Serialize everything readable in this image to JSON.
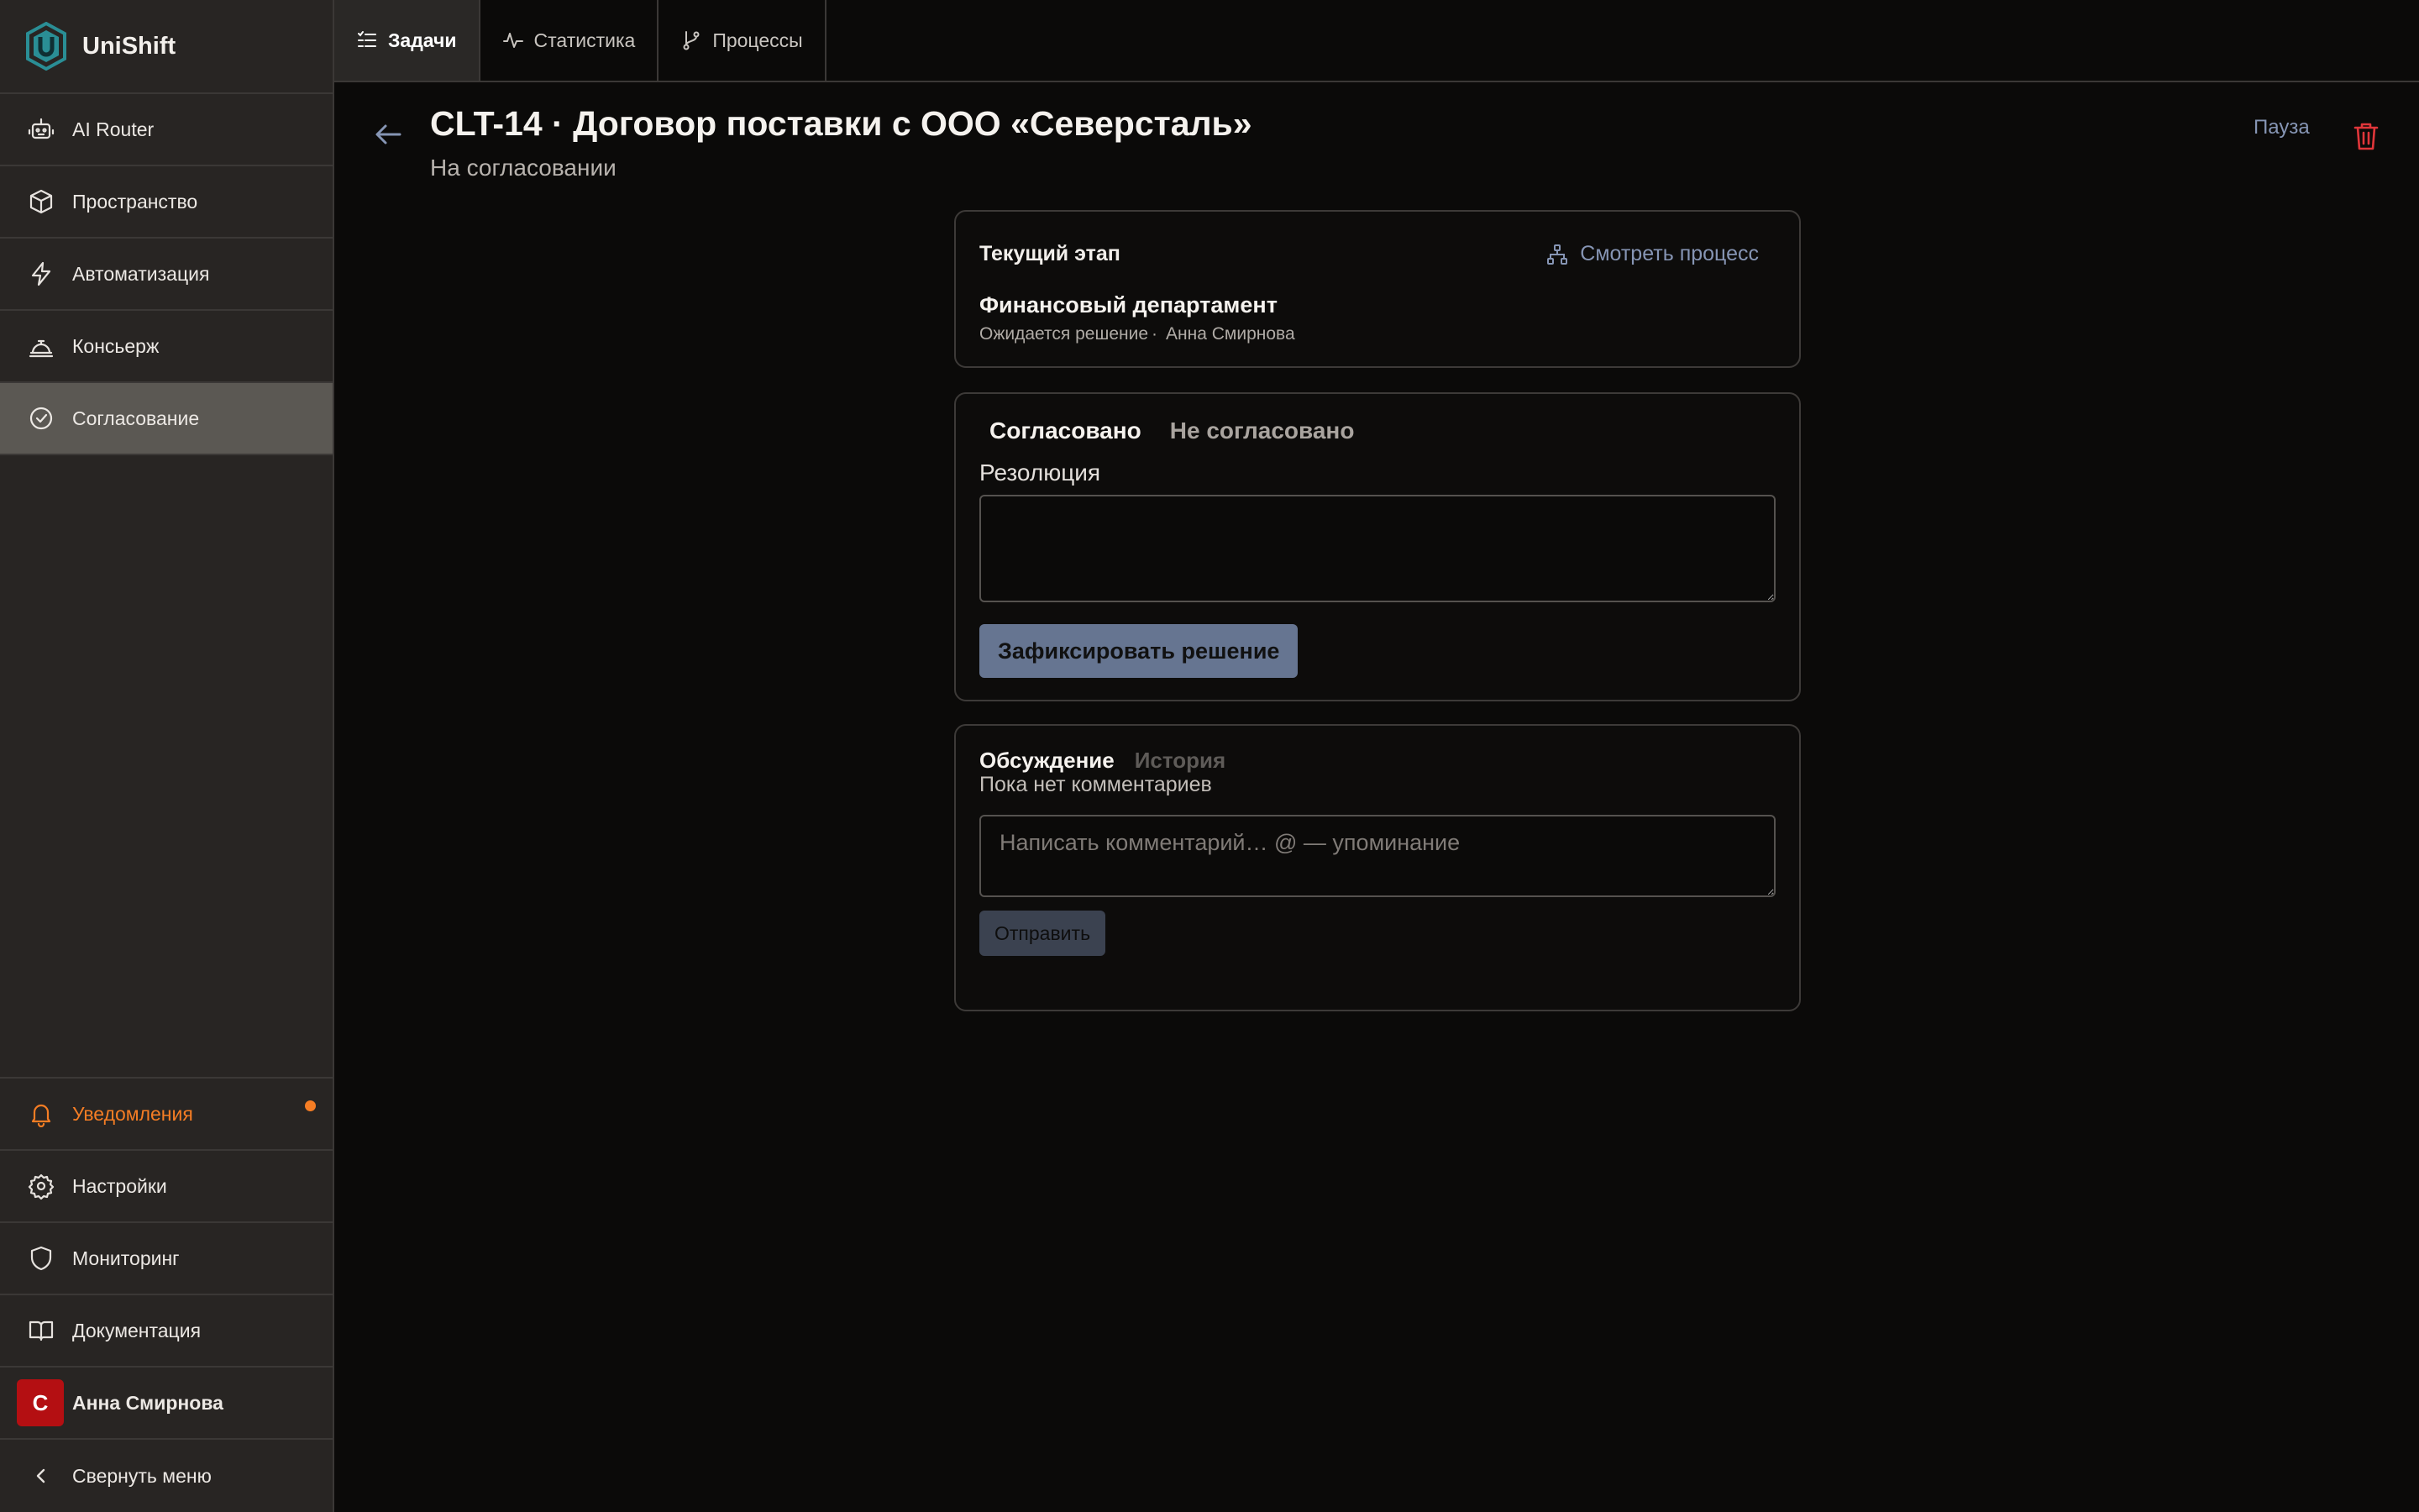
{
  "app": {
    "name": "UniShift",
    "brand_color": "#2a8e95"
  },
  "sidebar": {
    "items": [
      {
        "label": "AI Router",
        "icon": "robot-icon"
      },
      {
        "label": "Пространство",
        "icon": "box-icon"
      },
      {
        "label": "Автоматизация",
        "icon": "lightning-icon"
      },
      {
        "label": "Консьерж",
        "icon": "concierge-bell-icon"
      },
      {
        "label": "Согласование",
        "icon": "check-circle-icon",
        "active": true
      }
    ],
    "bottom": {
      "notifications": {
        "label": "Уведомления",
        "icon": "bell-icon",
        "color": "#f57d24"
      },
      "settings": {
        "label": "Настройки",
        "icon": "gear-icon"
      },
      "monitoring": {
        "label": "Мониторинг",
        "icon": "shield-icon"
      },
      "docs": {
        "label": "Документация",
        "icon": "book-icon"
      },
      "user": {
        "name": "Анна Смирнова",
        "avatar_letter": "С",
        "avatar_color": "#b40f12"
      },
      "collapse": {
        "label": "Свернуть меню",
        "icon": "chevron-left-icon"
      }
    }
  },
  "topbar": {
    "tabs": [
      {
        "label": "Задачи",
        "icon": "tasks-icon",
        "active": true
      },
      {
        "label": "Статистика",
        "icon": "activity-icon"
      },
      {
        "label": "Процессы",
        "icon": "branch-icon"
      }
    ]
  },
  "header": {
    "title": "CLT-14 · Договор поставки с ООО «Северсталь»",
    "status": "На согласовании",
    "pause_label": "Пауза",
    "trash_color": "#e0363a"
  },
  "stage": {
    "heading": "Текущий этап",
    "view_process": "Смотреть процесс",
    "name": "Финансовый департамент",
    "state": "Ожидается решение",
    "separator": "·",
    "assignee": "Анна Смирнова"
  },
  "decision": {
    "tab_approved": "Согласовано",
    "tab_rejected": "Не согласовано",
    "resolution_label": "Резолюция",
    "resolution_value": "",
    "submit_label": "Зафиксировать решение"
  },
  "discussion": {
    "tab_discussion": "Обсуждение",
    "tab_history": "История",
    "empty_text": "Пока нет комментариев",
    "comment_placeholder": "Написать комментарий… @ — упоминание",
    "send_label": "Отправить"
  }
}
